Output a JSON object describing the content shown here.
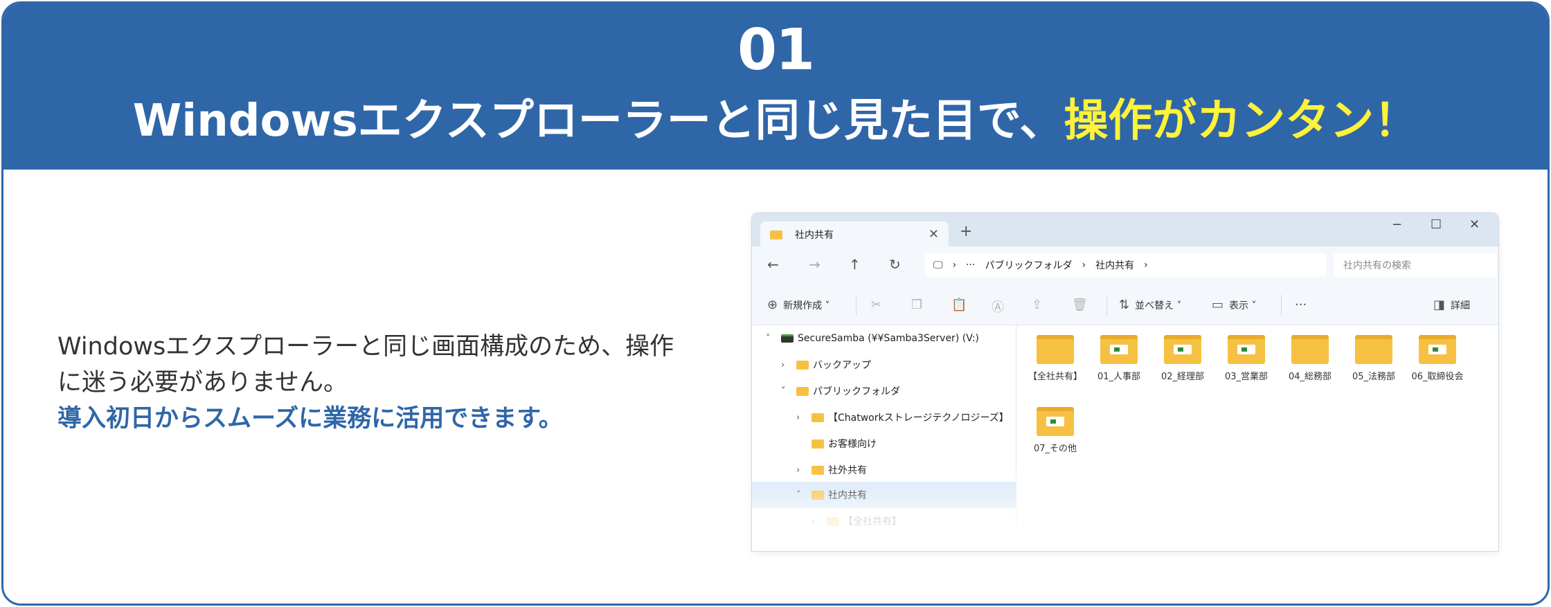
{
  "header": {
    "number": "01",
    "title_main": "Windowsエクスプローラーと同じ見た目で、",
    "title_highlight": "操作がカンタン！"
  },
  "description": {
    "line1": "Windowsエクスプローラーと同じ画面構成のため、操作に迷う必要がありません。",
    "line2": "導入初日からスムーズに業務に活用できます。"
  },
  "explorer": {
    "tab_label": "社内共有",
    "tab_close": "✕",
    "new_tab": "+",
    "window_controls": {
      "minimize": "−",
      "maximize": "☐",
      "close": "✕"
    },
    "nav": {
      "back": "←",
      "forward": "→",
      "up": "↑",
      "refresh": "↻"
    },
    "address": {
      "pc_icon": "🖵",
      "sep": "›",
      "more": "···",
      "crumb1": "パブリックフォルダ",
      "crumb2": "社内共有"
    },
    "search_placeholder": "社内共有の検索",
    "toolbar": {
      "new_icon": "⊕",
      "new_label": "新規作成 ˅",
      "cut_icon": "✂",
      "copy_icon": "❐",
      "paste_icon": "📋",
      "rename_icon": "Ⓐ",
      "share_icon": "⇪",
      "delete_icon": "🗑",
      "sort_icon": "⇅",
      "sort_label": "並べ替え ˅",
      "view_icon": "▭",
      "view_label": "表示 ˅",
      "more": "···",
      "details_icon": "◨",
      "details_label": "詳細"
    },
    "tree": [
      {
        "label": "SecureSamba (¥¥Samba3Server) (V:)",
        "chev": "˅"
      },
      {
        "label": "バックアップ",
        "chev": "›"
      },
      {
        "label": "パブリックフォルダ",
        "chev": "˅"
      },
      {
        "label": "【Chatworkストレージテクノロジーズ】",
        "chev": "›"
      },
      {
        "label": "お客様向け",
        "chev": ""
      },
      {
        "label": "社外共有",
        "chev": "›"
      },
      {
        "label": "社内共有",
        "chev": "˅"
      },
      {
        "label": "【全社共有】",
        "chev": "›"
      }
    ],
    "folders": [
      "【全社共有】",
      "01_人事部",
      "02_経理部",
      "03_営業部",
      "04_総務部",
      "05_法務部",
      "06_取締役会",
      "07_その他"
    ]
  }
}
